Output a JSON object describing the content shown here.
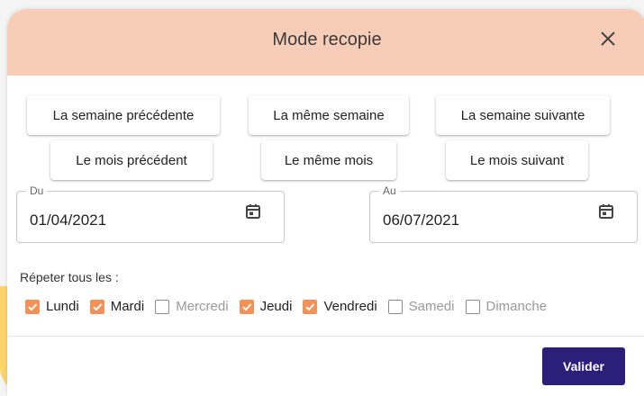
{
  "dialog": {
    "title": "Mode recopie",
    "close_icon": "close-icon"
  },
  "quick_buttons": {
    "prev_week": "La semaine précédente",
    "same_week": "La même semaine",
    "next_week": "La semaine suivante",
    "prev_month": "Le mois précédent",
    "same_month": "Le même mois",
    "next_month": "Le mois suivant"
  },
  "date_from": {
    "label": "Du",
    "value": "01/04/2021",
    "icon": "calendar-icon"
  },
  "date_to": {
    "label": "Au",
    "value": "06/07/2021",
    "icon": "calendar-icon"
  },
  "repeat": {
    "label": "Répeter tous les :",
    "days": [
      {
        "name": "Lundi",
        "checked": true
      },
      {
        "name": "Mardi",
        "checked": true
      },
      {
        "name": "Mercredi",
        "checked": false
      },
      {
        "name": "Jeudi",
        "checked": true
      },
      {
        "name": "Vendredi",
        "checked": true
      },
      {
        "name": "Samedi",
        "checked": false
      },
      {
        "name": "Dimanche",
        "checked": false
      }
    ]
  },
  "actions": {
    "validate_label": "Valider"
  },
  "colors": {
    "header_bg": "#f8cdb8",
    "checkbox_checked": "#f29259",
    "primary_button": "#2b1f7a"
  }
}
